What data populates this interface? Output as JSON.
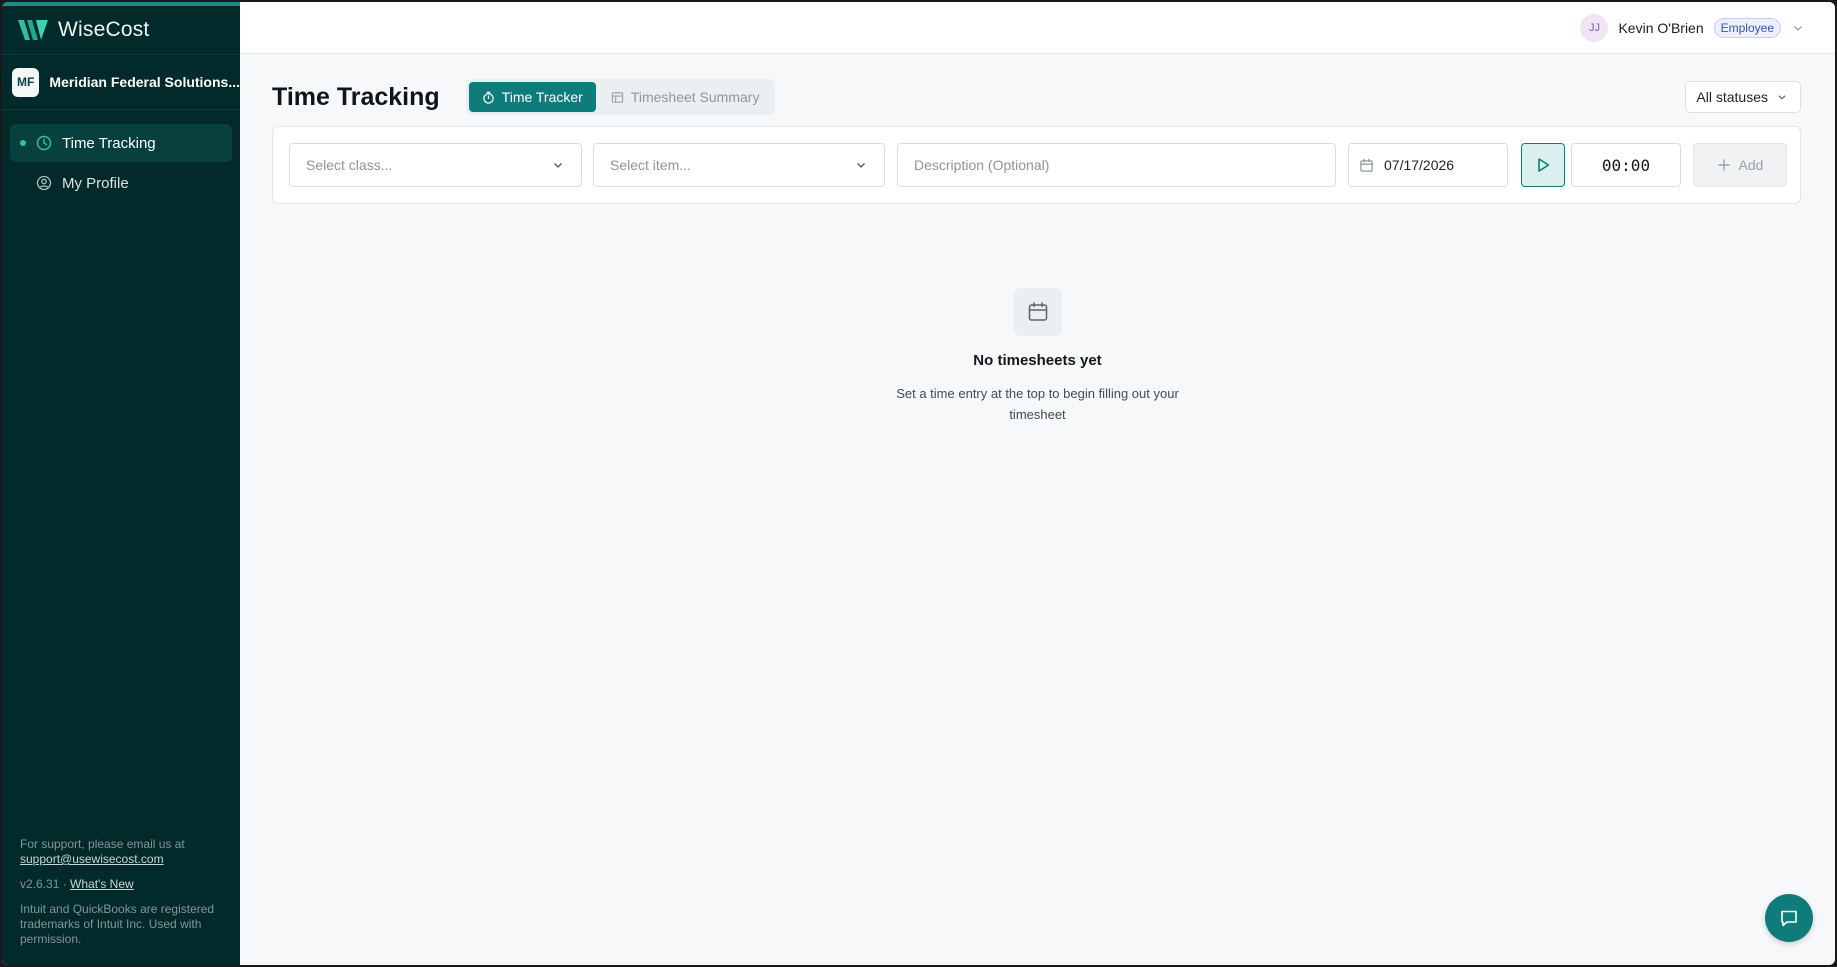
{
  "brand": {
    "name": "WiseCost"
  },
  "org": {
    "initials": "MF",
    "name": "Meridian Federal Solutions..."
  },
  "nav": {
    "items": [
      {
        "label": "Time Tracking",
        "icon": "clock-icon",
        "active": true
      },
      {
        "label": "My Profile",
        "icon": "user-circle-icon",
        "active": false
      }
    ]
  },
  "footer": {
    "support_text": "For support, please email us at",
    "support_email": "support@usewisecost.com",
    "version": "v2.6.31 ·",
    "whats_new": "What's New",
    "trademark": "Intuit and QuickBooks are registered trademarks of Intuit Inc. Used with permission."
  },
  "user": {
    "initials": "JJ",
    "name": "Kevin O'Brien",
    "role": "Employee"
  },
  "page": {
    "title": "Time Tracking",
    "tabs": [
      {
        "label": "Time Tracker",
        "icon": "stopwatch-icon",
        "active": true
      },
      {
        "label": "Timesheet Summary",
        "icon": "table-icon",
        "active": false
      }
    ],
    "status_filter": "All statuses"
  },
  "entry": {
    "class_placeholder": "Select class...",
    "item_placeholder": "Select item...",
    "description_placeholder": "Description (Optional)",
    "date": "07/17/2026",
    "timer": "00:00",
    "add_label": "Add"
  },
  "empty_state": {
    "title": "No timesheets yet",
    "text": "Set a time entry at the top to begin filling out your timesheet"
  },
  "colors": {
    "sidebar": "#032a2a",
    "accent": "#0e7c7b",
    "accent_light": "#d9f0ee"
  }
}
